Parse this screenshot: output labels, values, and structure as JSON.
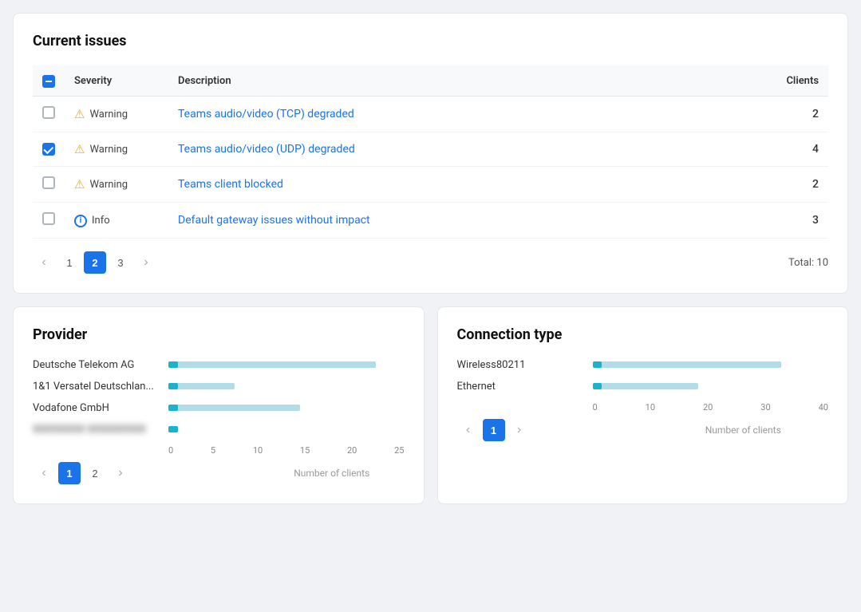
{
  "current_issues": {
    "title": "Current issues",
    "table": {
      "columns": [
        {
          "key": "checkbox",
          "label": ""
        },
        {
          "key": "severity",
          "label": "Severity"
        },
        {
          "key": "description",
          "label": "Description"
        },
        {
          "key": "clients",
          "label": "Clients"
        }
      ],
      "rows": [
        {
          "id": 1,
          "checked": false,
          "severity_icon": "warning",
          "severity_label": "Warning",
          "description": "Teams audio/video (TCP) degraded",
          "clients": 2
        },
        {
          "id": 2,
          "checked": true,
          "severity_icon": "warning",
          "severity_label": "Warning",
          "description": "Teams audio/video (UDP) degraded",
          "clients": 4
        },
        {
          "id": 3,
          "checked": false,
          "severity_icon": "warning",
          "severity_label": "Warning",
          "description": "Teams client blocked",
          "clients": 2
        },
        {
          "id": 4,
          "checked": false,
          "severity_icon": "info",
          "severity_label": "Info",
          "description": "Default gateway issues without impact",
          "clients": 3
        }
      ]
    },
    "pagination": {
      "prev_label": "‹",
      "next_label": "›",
      "pages": [
        1,
        2,
        3
      ],
      "active_page": 2,
      "total_label": "Total: 10"
    }
  },
  "provider": {
    "title": "Provider",
    "rows": [
      {
        "label": "Deutsche Telekom AG",
        "value": 22,
        "max": 25
      },
      {
        "label": "1&1 Versatel Deutschlan...",
        "value": 7,
        "max": 25
      },
      {
        "label": "Vodafone GmbH",
        "value": 14,
        "max": 25
      },
      {
        "label": "BLURRED",
        "value": 1,
        "max": 25
      }
    ],
    "x_axis": [
      "0",
      "5",
      "10",
      "15",
      "20",
      "25"
    ],
    "axis_label": "Number of clients",
    "pagination": {
      "pages": [
        1,
        2
      ],
      "active_page": 1
    }
  },
  "connection_type": {
    "title": "Connection type",
    "rows": [
      {
        "label": "Wireless80211",
        "value": 32,
        "max": 40
      },
      {
        "label": "Ethernet",
        "value": 18,
        "max": 40
      }
    ],
    "x_axis": [
      "0",
      "10",
      "20",
      "30",
      "40"
    ],
    "axis_label": "Number of clients",
    "pagination": {
      "pages": [
        1
      ],
      "active_page": 1
    }
  },
  "icons": {
    "warning": "⚠",
    "info": "i",
    "prev_arrow": "‹",
    "next_arrow": "›",
    "indeterminate": "—"
  }
}
